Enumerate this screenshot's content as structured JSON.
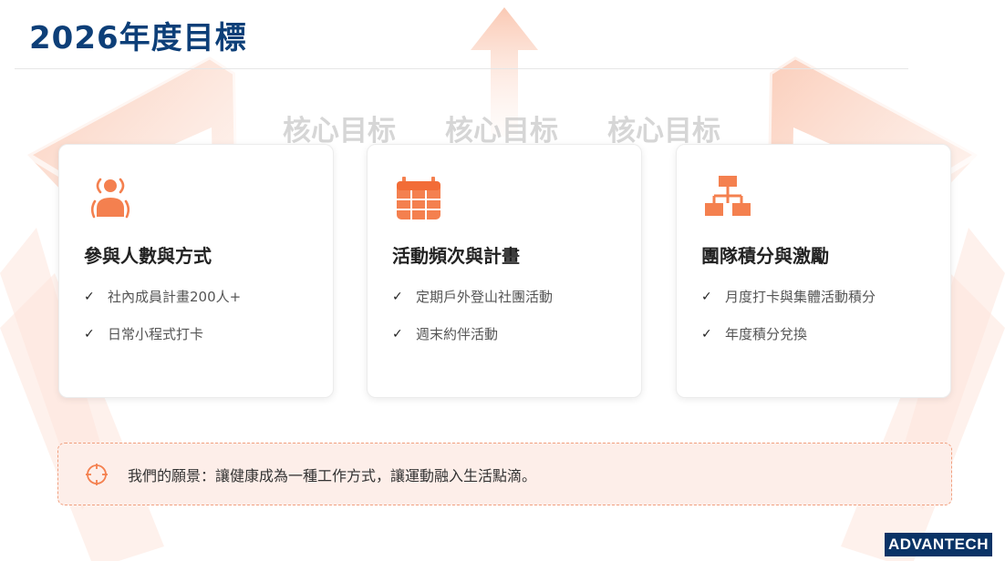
{
  "header": {
    "title": "2026年度目標"
  },
  "watermark": {
    "words": [
      "核心目标",
      "核心目标",
      "核心目标"
    ]
  },
  "cards": [
    {
      "icon": "person-broadcast-icon",
      "title": "參與人數與方式",
      "items": [
        "社內成員計畫200人+",
        "日常小程式打卡"
      ]
    },
    {
      "icon": "calendar-icon",
      "title": "活動頻次與計畫",
      "items": [
        "定期戶外登山社團活動",
        "週末約伴活動"
      ]
    },
    {
      "icon": "org-chart-icon",
      "title": "團隊積分與激勵",
      "items": [
        "月度打卡與集體活動積分",
        "年度積分兌換"
      ]
    }
  ],
  "vision": {
    "icon": "target-icon",
    "text": "我們的願景：讓健康成為一種工作方式，讓運動融入生活點滴。"
  },
  "logo": {
    "text": "ADVANTECH"
  },
  "colors": {
    "accent": "#f4804f",
    "title": "#0d3f78",
    "vision_bg": "#fdeee9",
    "logo_bg": "#0a3366"
  }
}
